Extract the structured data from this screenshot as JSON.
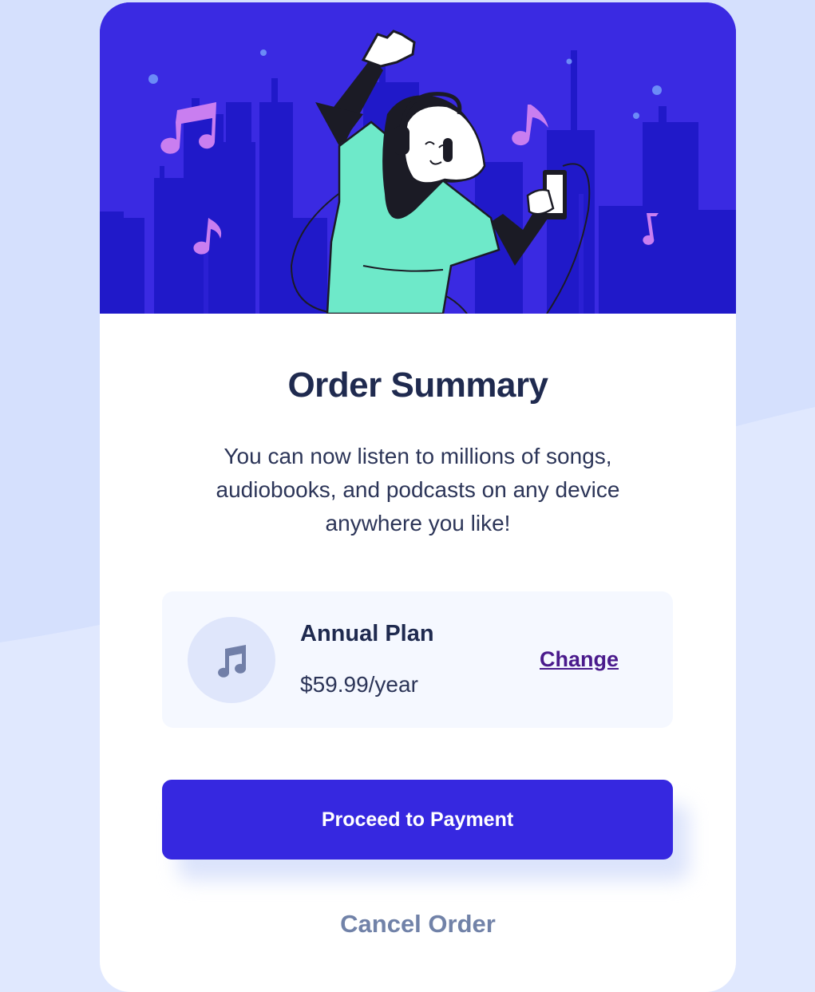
{
  "order": {
    "title": "Order Summary",
    "description": "You can now listen to millions of songs, audiobooks, and podcasts on any device anywhere you like!",
    "plan": {
      "icon": "music-note-icon",
      "name": "Annual Plan",
      "price": "$59.99/year",
      "change_label": "Change"
    },
    "proceed_label": "Proceed to Payment",
    "cancel_label": "Cancel Order"
  },
  "colors": {
    "background": "#e0e8fe",
    "hero": "#3a2ae2",
    "primary_button": "#3628e0",
    "heading": "#1f2a4f",
    "link": "#4a1a8c",
    "muted": "#7182a8"
  }
}
